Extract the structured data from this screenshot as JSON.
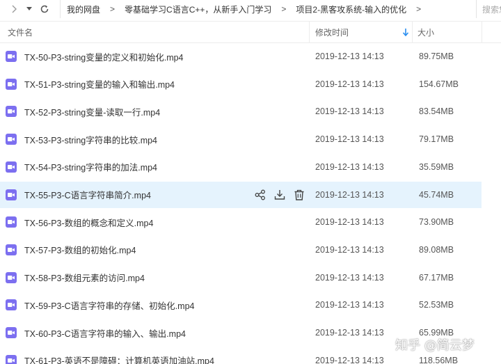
{
  "nav": {
    "breadcrumbs": [
      "我的网盘",
      "零基础学习C语言C++，从新手入门学习",
      "项目2-黑客攻系统-输入的优化"
    ],
    "separator": ">",
    "search_placeholder": "搜索您"
  },
  "columns": {
    "name": "文件名",
    "modified": "修改时间",
    "size": "大小"
  },
  "files": [
    {
      "name": "TX-50-P3-string变量的定义和初始化.mp4",
      "modified": "2019-12-13 14:13",
      "size": "89.75MB",
      "selected": false
    },
    {
      "name": "TX-51-P3-string变量的输入和输出.mp4",
      "modified": "2019-12-13 14:13",
      "size": "154.67MB",
      "selected": false
    },
    {
      "name": "TX-52-P3-string变量-读取一行.mp4",
      "modified": "2019-12-13 14:13",
      "size": "83.54MB",
      "selected": false
    },
    {
      "name": "TX-53-P3-string字符串的比较.mp4",
      "modified": "2019-12-13 14:13",
      "size": "79.17MB",
      "selected": false
    },
    {
      "name": "TX-54-P3-string字符串的加法.mp4",
      "modified": "2019-12-13 14:13",
      "size": "35.59MB",
      "selected": false
    },
    {
      "name": "TX-55-P3-C语言字符串简介.mp4",
      "modified": "2019-12-13 14:13",
      "size": "45.74MB",
      "selected": true
    },
    {
      "name": "TX-56-P3-数组的概念和定义.mp4",
      "modified": "2019-12-13 14:13",
      "size": "73.90MB",
      "selected": false
    },
    {
      "name": "TX-57-P3-数组的初始化.mp4",
      "modified": "2019-12-13 14:13",
      "size": "89.08MB",
      "selected": false
    },
    {
      "name": "TX-58-P3-数组元素的访问.mp4",
      "modified": "2019-12-13 14:13",
      "size": "67.17MB",
      "selected": false
    },
    {
      "name": "TX-59-P3-C语言字符串的存储、初始化.mp4",
      "modified": "2019-12-13 14:13",
      "size": "52.53MB",
      "selected": false
    },
    {
      "name": "TX-60-P3-C语言字符串的输入、输出.mp4",
      "modified": "2019-12-13 14:13",
      "size": "65.99MB",
      "selected": false
    },
    {
      "name": "TX-61-P3-英语不是障碍：计算机英语加油站.mp4",
      "modified": "2019-12-13 14:13",
      "size": "118.56MB",
      "selected": false
    }
  ],
  "row_actions": [
    "share-icon",
    "download-icon",
    "delete-icon"
  ],
  "file_icon": "video-file-icon",
  "colors": {
    "accent": "#2a8ef0",
    "file_icon": "#7c6ff0",
    "selected_row": "#e5f3fd",
    "sort_arrow": "#2a8ef0"
  },
  "watermark": "知乎 @简云梦"
}
